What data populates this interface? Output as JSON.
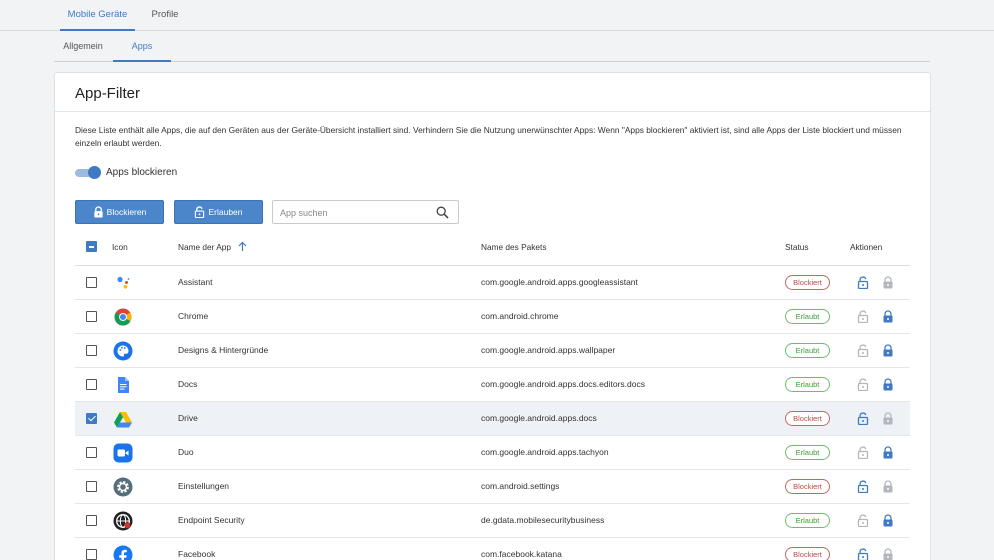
{
  "top_tabs": [
    "Mobile Geräte",
    "Profile"
  ],
  "sub_tabs": [
    "Allgemein",
    "Apps"
  ],
  "card": {
    "title": "App-Filter",
    "description": "Diese Liste enthält alle Apps, die auf den Geräten aus der Geräte-Übersicht installiert sind. Verhindern Sie die Nutzung unerwünschter Apps: Wenn \"Apps blockieren\" aktiviert ist, sind alle Apps der Liste blockiert und müssen einzeln erlaubt werden.",
    "toggle_label": "Apps blockieren",
    "toggle_on": true
  },
  "toolbar": {
    "block_label": "Blockieren",
    "allow_label": "Erlauben",
    "search_placeholder": "App suchen"
  },
  "table": {
    "columns": [
      "Icon",
      "Name der App",
      "Name des Pakets",
      "Status",
      "Aktionen"
    ],
    "sort_icon": "arrow-up-icon",
    "rows": [
      {
        "icon": "assistant-icon",
        "name": "Assistant",
        "package": "com.google.android.apps.googleassistant",
        "status": "Blockiert",
        "checked": false
      },
      {
        "icon": "chrome-icon",
        "name": "Chrome",
        "package": "com.android.chrome",
        "status": "Erlaubt",
        "checked": false
      },
      {
        "icon": "palette-icon",
        "name": "Designs & Hintergründe",
        "package": "com.google.android.apps.wallpaper",
        "status": "Erlaubt",
        "checked": false
      },
      {
        "icon": "docs-icon",
        "name": "Docs",
        "package": "com.google.android.apps.docs.editors.docs",
        "status": "Erlaubt",
        "checked": false
      },
      {
        "icon": "drive-icon",
        "name": "Drive",
        "package": "com.google.android.apps.docs",
        "status": "Blockiert",
        "checked": true
      },
      {
        "icon": "duo-icon",
        "name": "Duo",
        "package": "com.google.android.apps.tachyon",
        "status": "Erlaubt",
        "checked": false
      },
      {
        "icon": "settings-icon",
        "name": "Einstellungen",
        "package": "com.android.settings",
        "status": "Blockiert",
        "checked": false
      },
      {
        "icon": "gdata-icon",
        "name": "Endpoint Security",
        "package": "de.gdata.mobilesecuritybusiness",
        "status": "Erlaubt",
        "checked": false
      },
      {
        "icon": "facebook-icon",
        "name": "Facebook",
        "package": "com.facebook.katana",
        "status": "Blockiert",
        "checked": false
      }
    ]
  },
  "colors": {
    "accent": "#3f7ac2",
    "blocked": "#c96565",
    "allowed": "#6bbf6b",
    "lock_inactive": "#b3b7bc"
  }
}
